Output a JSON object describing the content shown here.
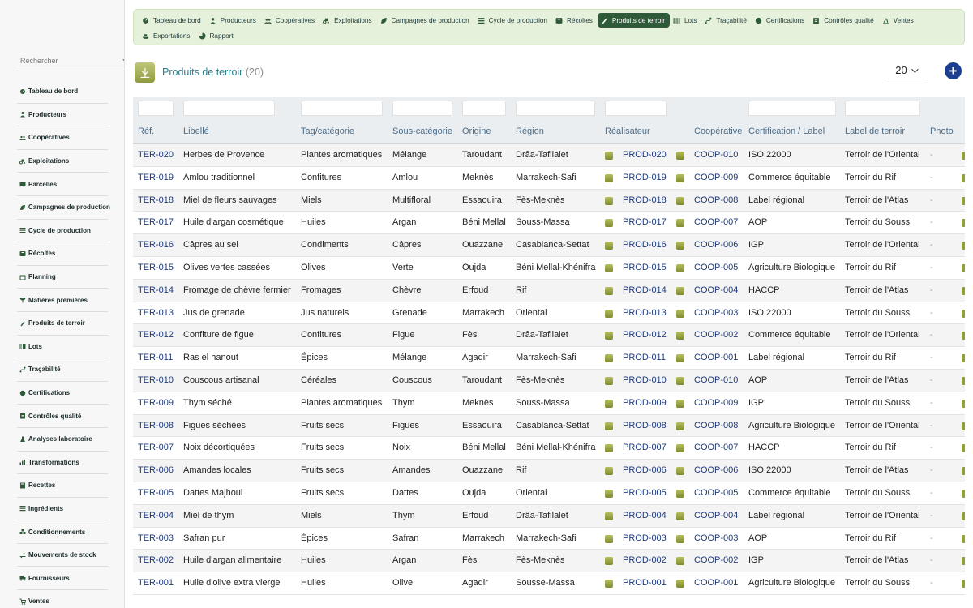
{
  "search": {
    "placeholder": "Rechercher"
  },
  "sidebar": {
    "items": [
      {
        "label": "Tableau de bord",
        "icon": "dashboard-icon"
      },
      {
        "label": "Producteurs",
        "icon": "user-icon"
      },
      {
        "label": "Coopératives",
        "icon": "users-icon"
      },
      {
        "label": "Exploitations",
        "icon": "tractor-icon"
      },
      {
        "label": "Parcelles",
        "icon": "map-icon"
      },
      {
        "label": "Campagnes de production",
        "icon": "leaf-icon"
      },
      {
        "label": "Cycle de production",
        "icon": "list-icon"
      },
      {
        "label": "Récoltes",
        "icon": "box-icon"
      },
      {
        "label": "Planning",
        "icon": "calendar-icon"
      },
      {
        "label": "Matières premières",
        "icon": "seedling-icon"
      },
      {
        "label": "Produits de terroir",
        "icon": "pen-icon"
      },
      {
        "label": "Lots",
        "icon": "barcode-icon"
      },
      {
        "label": "Traçabilité",
        "icon": "route-icon"
      },
      {
        "label": "Certifications",
        "icon": "badge-icon"
      },
      {
        "label": "Contrôles qualité",
        "icon": "clipboard-icon"
      },
      {
        "label": "Analyses laboratoire",
        "icon": "flask-icon"
      },
      {
        "label": "Transformations",
        "icon": "chart-icon"
      },
      {
        "label": "Recettes",
        "icon": "book-icon"
      },
      {
        "label": "Ingrédients",
        "icon": "list-icon"
      },
      {
        "label": "Conditionnements",
        "icon": "boxes-icon"
      },
      {
        "label": "Mouvements de stock",
        "icon": "exchange-icon"
      },
      {
        "label": "Fournisseurs",
        "icon": "truck-icon"
      },
      {
        "label": "Ventes",
        "icon": "cart-icon"
      }
    ]
  },
  "topnav": {
    "tabs": [
      {
        "label": "Tableau de bord",
        "icon": "dashboard-icon",
        "active": false
      },
      {
        "label": "Producteurs",
        "icon": "user-icon",
        "active": false
      },
      {
        "label": "Coopératives",
        "icon": "users-icon",
        "active": false
      },
      {
        "label": "Exploitations",
        "icon": "tractor-icon",
        "active": false
      },
      {
        "label": "Campagnes de production",
        "icon": "leaf-icon",
        "active": false
      },
      {
        "label": "Cycle de production",
        "icon": "list-icon",
        "active": false
      },
      {
        "label": "Récoltes",
        "icon": "box-icon",
        "active": false
      },
      {
        "label": "Produits de terroir",
        "icon": "pen-icon",
        "active": true
      },
      {
        "label": "Lots",
        "icon": "barcode-icon",
        "active": false
      },
      {
        "label": "Traçabilité",
        "icon": "route-icon",
        "active": false
      },
      {
        "label": "Certifications",
        "icon": "badge-icon",
        "active": false
      },
      {
        "label": "Contrôles qualité",
        "icon": "clipboard-icon",
        "active": false
      },
      {
        "label": "Ventes",
        "icon": "hand-icon",
        "active": false
      },
      {
        "label": "Exportations",
        "icon": "ship-icon",
        "active": false
      },
      {
        "label": "Rapport",
        "icon": "pie-icon",
        "active": false
      }
    ]
  },
  "header": {
    "title": "Produits de terroir",
    "count": "(20)",
    "page_size": "20",
    "add_label": "+"
  },
  "table": {
    "columns": [
      "Réf.",
      "Libellé",
      "Tag/catégorie",
      "Sous-catégorie",
      "Origine",
      "Région",
      "Réalisateur",
      "Coopérative",
      "Certification / Label",
      "Label de terroir",
      "Photo"
    ],
    "rows": [
      [
        "TER-020",
        "Herbes de Provence",
        "Plantes aromatiques",
        "Mélange",
        "Taroudant",
        "Drâa-Tafilalet",
        "PROD-020",
        "COOP-010",
        "ISO 22000",
        "Terroir de l'Oriental",
        "-"
      ],
      [
        "TER-019",
        "Amlou traditionnel",
        "Confitures",
        "Amlou",
        "Meknès",
        "Marrakech-Safi",
        "PROD-019",
        "COOP-009",
        "Commerce équitable",
        "Terroir du Rif",
        "-"
      ],
      [
        "TER-018",
        "Miel de fleurs sauvages",
        "Miels",
        "Multifloral",
        "Essaouira",
        "Fès-Meknès",
        "PROD-018",
        "COOP-008",
        "Label régional",
        "Terroir de l'Atlas",
        "-"
      ],
      [
        "TER-017",
        "Huile d'argan cosmétique",
        "Huiles",
        "Argan",
        "Béni Mellal",
        "Souss-Massa",
        "PROD-017",
        "COOP-007",
        "AOP",
        "Terroir du Souss",
        "-"
      ],
      [
        "TER-016",
        "Câpres au sel",
        "Condiments",
        "Câpres",
        "Ouazzane",
        "Casablanca-Settat",
        "PROD-016",
        "COOP-006",
        "IGP",
        "Terroir de l'Oriental",
        "-"
      ],
      [
        "TER-015",
        "Olives vertes cassées",
        "Olives",
        "Verte",
        "Oujda",
        "Béni Mellal-Khénifra",
        "PROD-015",
        "COOP-005",
        "Agriculture Biologique",
        "Terroir du Rif",
        "-"
      ],
      [
        "TER-014",
        "Fromage de chèvre fermier",
        "Fromages",
        "Chèvre",
        "Erfoud",
        "Rif",
        "PROD-014",
        "COOP-004",
        "HACCP",
        "Terroir de l'Atlas",
        "-"
      ],
      [
        "TER-013",
        "Jus de grenade",
        "Jus naturels",
        "Grenade",
        "Marrakech",
        "Oriental",
        "PROD-013",
        "COOP-003",
        "ISO 22000",
        "Terroir du Souss",
        "-"
      ],
      [
        "TER-012",
        "Confiture de figue",
        "Confitures",
        "Figue",
        "Fès",
        "Drâa-Tafilalet",
        "PROD-012",
        "COOP-002",
        "Commerce équitable",
        "Terroir de l'Oriental",
        "-"
      ],
      [
        "TER-011",
        "Ras el hanout",
        "Épices",
        "Mélange",
        "Agadir",
        "Marrakech-Safi",
        "PROD-011",
        "COOP-001",
        "Label régional",
        "Terroir du Rif",
        "-"
      ],
      [
        "TER-010",
        "Couscous artisanal",
        "Céréales",
        "Couscous",
        "Taroudant",
        "Fès-Meknès",
        "PROD-010",
        "COOP-010",
        "AOP",
        "Terroir de l'Atlas",
        "-"
      ],
      [
        "TER-009",
        "Thym séché",
        "Plantes aromatiques",
        "Thym",
        "Meknès",
        "Souss-Massa",
        "PROD-009",
        "COOP-009",
        "IGP",
        "Terroir du Souss",
        "-"
      ],
      [
        "TER-008",
        "Figues séchées",
        "Fruits secs",
        "Figues",
        "Essaouira",
        "Casablanca-Settat",
        "PROD-008",
        "COOP-008",
        "Agriculture Biologique",
        "Terroir de l'Oriental",
        "-"
      ],
      [
        "TER-007",
        "Noix décortiquées",
        "Fruits secs",
        "Noix",
        "Béni Mellal",
        "Béni Mellal-Khénifra",
        "PROD-007",
        "COOP-007",
        "HACCP",
        "Terroir du Rif",
        "-"
      ],
      [
        "TER-006",
        "Amandes locales",
        "Fruits secs",
        "Amandes",
        "Ouazzane",
        "Rif",
        "PROD-006",
        "COOP-006",
        "ISO 22000",
        "Terroir de l'Atlas",
        "-"
      ],
      [
        "TER-005",
        "Dattes Majhoul",
        "Fruits secs",
        "Dattes",
        "Oujda",
        "Oriental",
        "PROD-005",
        "COOP-005",
        "Commerce équitable",
        "Terroir du Souss",
        "-"
      ],
      [
        "TER-004",
        "Miel de thym",
        "Miels",
        "Thym",
        "Erfoud",
        "Drâa-Tafilalet",
        "PROD-004",
        "COOP-004",
        "Label régional",
        "Terroir de l'Oriental",
        "-"
      ],
      [
        "TER-003",
        "Safran pur",
        "Épices",
        "Safran",
        "Marrakech",
        "Marrakech-Safi",
        "PROD-003",
        "COOP-003",
        "AOP",
        "Terroir du Rif",
        "-"
      ],
      [
        "TER-002",
        "Huile d'argan alimentaire",
        "Huiles",
        "Argan",
        "Fès",
        "Fès-Meknès",
        "PROD-002",
        "COOP-002",
        "IGP",
        "Terroir de l'Atlas",
        "-"
      ],
      [
        "TER-001",
        "Huile d'olive extra vierge",
        "Huiles",
        "Olive",
        "Agadir",
        "Sousse-Massa",
        "PROD-001",
        "COOP-001",
        "Agriculture Biologique",
        "Terroir du Souss",
        "-"
      ]
    ]
  }
}
